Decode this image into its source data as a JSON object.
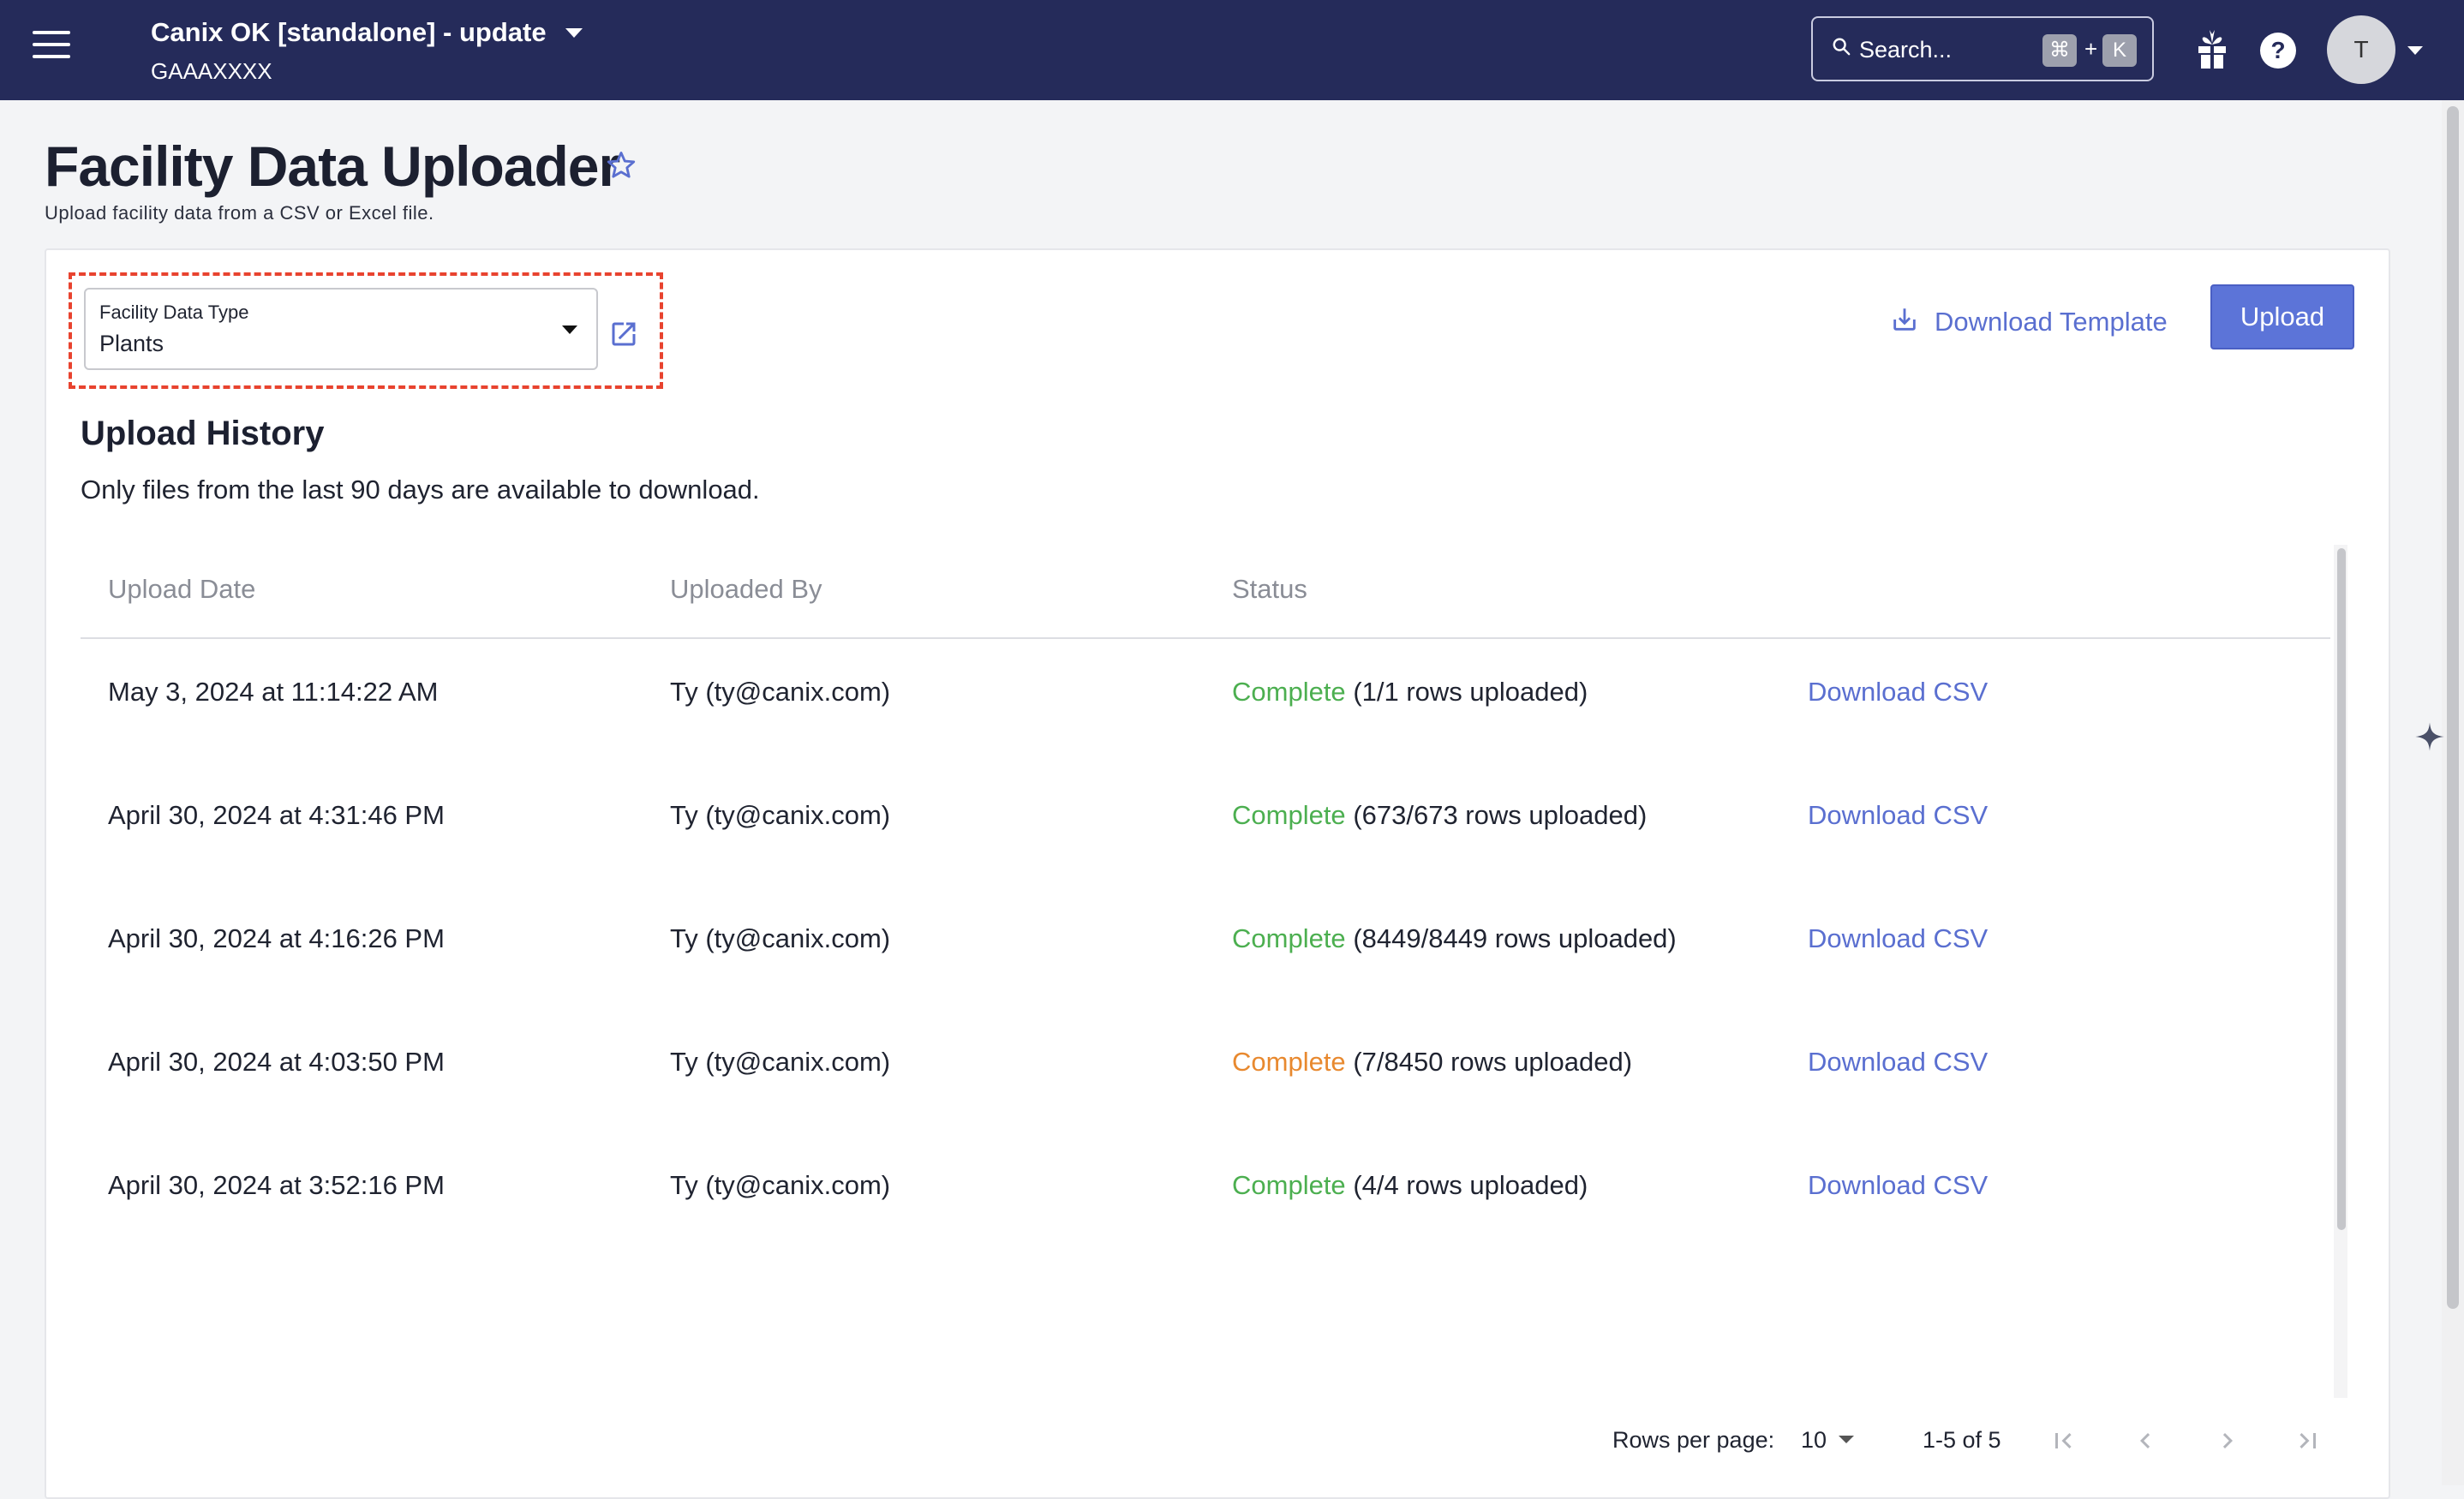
{
  "header": {
    "org_name": "Canix OK [standalone] - update",
    "org_code": "GAAAXXXX",
    "search_placeholder": "Search...",
    "shortcut_modifier": "⌘",
    "shortcut_plus": "+",
    "shortcut_key": "K",
    "help_glyph": "?",
    "avatar_initial": "T",
    "background_color": "#252b5a"
  },
  "page": {
    "title": "Facility Data Uploader",
    "subtitle": "Upload facility data from a CSV or Excel file."
  },
  "facility_select": {
    "label": "Facility Data Type",
    "value": "Plants"
  },
  "actions": {
    "download_template": "Download Template",
    "upload": "Upload",
    "accent_color": "#5c74d8"
  },
  "history": {
    "title": "Upload History",
    "note": "Only files from the last 90 days are available to download.",
    "columns": [
      "Upload Date",
      "Uploaded By",
      "Status"
    ],
    "rows": [
      {
        "date": "May 3, 2024 at 11:14:22 AM",
        "by": "Ty (ty@canix.com)",
        "status": "Complete",
        "status_kind": "ok",
        "detail": "(1/1 rows uploaded)",
        "action": "Download CSV"
      },
      {
        "date": "April 30, 2024 at 4:31:46 PM",
        "by": "Ty (ty@canix.com)",
        "status": "Complete",
        "status_kind": "ok",
        "detail": "(673/673 rows uploaded)",
        "action": "Download CSV"
      },
      {
        "date": "April 30, 2024 at 4:16:26 PM",
        "by": "Ty (ty@canix.com)",
        "status": "Complete",
        "status_kind": "ok",
        "detail": "(8449/8449 rows uploaded)",
        "action": "Download CSV"
      },
      {
        "date": "April 30, 2024 at 4:03:50 PM",
        "by": "Ty (ty@canix.com)",
        "status": "Complete",
        "status_kind": "warn",
        "detail": "(7/8450 rows uploaded)",
        "action": "Download CSV"
      },
      {
        "date": "April 30, 2024 at 3:52:16 PM",
        "by": "Ty (ty@canix.com)",
        "status": "Complete",
        "status_kind": "ok",
        "detail": "(4/4 rows uploaded)",
        "action": "Download CSV"
      }
    ]
  },
  "pagination": {
    "rows_per_page_label": "Rows per page:",
    "rows_per_page": "10",
    "range": "1-5 of 5"
  },
  "icons": {
    "menu": "hamburger-icon",
    "search": "search-icon",
    "gift": "gift-icon",
    "help": "help-icon",
    "favorite": "star-outline-icon",
    "open_external": "open-in-new-icon",
    "download": "download-icon",
    "assistant": "sparkle-icon"
  }
}
